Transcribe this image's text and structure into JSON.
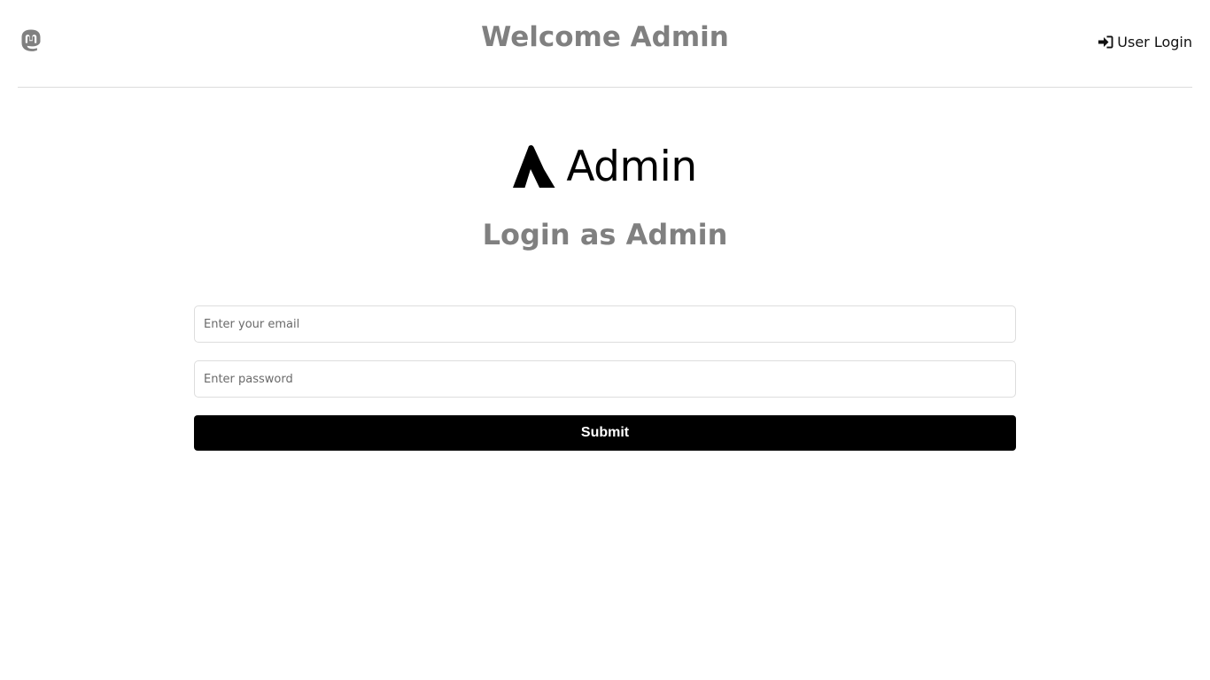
{
  "header": {
    "logo_icon": "mastodon-icon",
    "title": "Welcome Admin",
    "user_login": {
      "icon": "sign-in-icon",
      "label": "User Login"
    }
  },
  "brand": {
    "icon": "atlassian-icon",
    "label": "Admin"
  },
  "login_heading": "Login as Admin",
  "form": {
    "email_placeholder": "Enter your email",
    "email_value": "",
    "password_placeholder": "Enter password",
    "password_value": "",
    "submit_label": "Submit"
  },
  "colors": {
    "heading_gray": "#808080",
    "button_bg": "#000000",
    "button_text": "#ffffff",
    "divider": "#dcdcdc"
  }
}
